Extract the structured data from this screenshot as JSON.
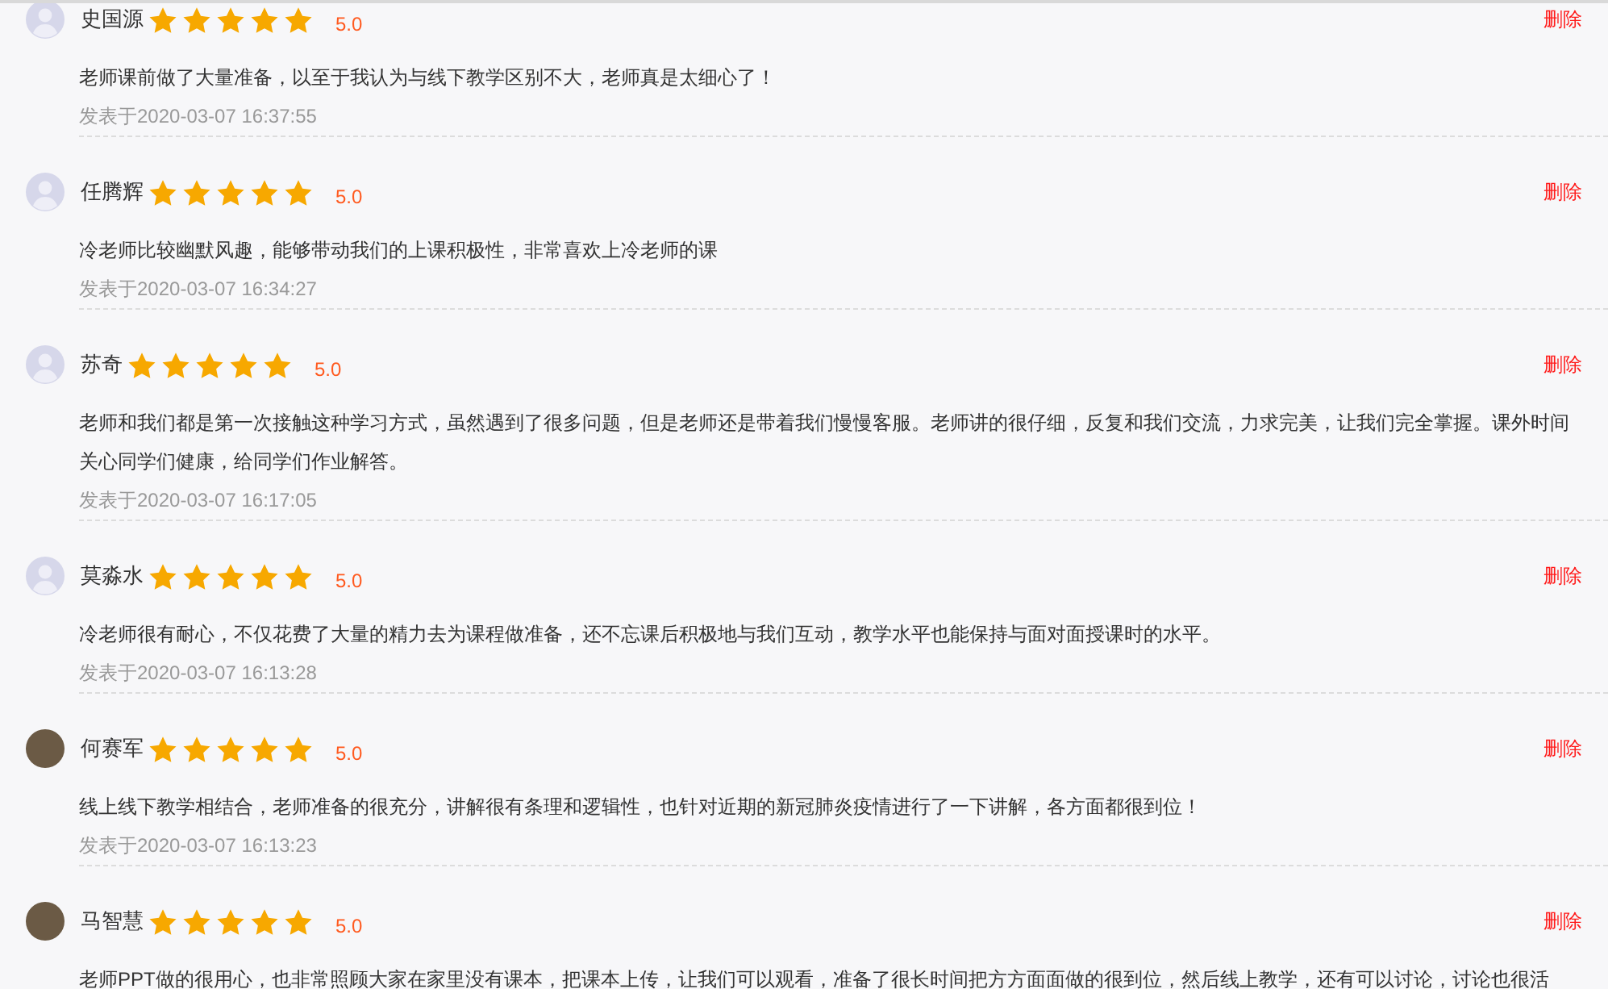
{
  "reviews": [
    {
      "name": "史国源",
      "avatar": {
        "kind": "default"
      },
      "stars": 5,
      "score": "5.0",
      "delete": "删除",
      "comment": "老师课前做了大量准备，以至于我认为与线下教学区别不大，老师真是太细心了！",
      "date": "发表于2020-03-07 16:37:55"
    },
    {
      "name": "任腾辉",
      "avatar": {
        "kind": "default"
      },
      "stars": 5,
      "score": "5.0",
      "delete": "删除",
      "comment": "冷老师比较幽默风趣，能够带动我们的上课积极性，非常喜欢上冷老师的课",
      "date": "发表于2020-03-07 16:34:27"
    },
    {
      "name": "苏奇",
      "avatar": {
        "kind": "default"
      },
      "stars": 5,
      "score": "5.0",
      "delete": "删除",
      "comment": "老师和我们都是第一次接触这种学习方式，虽然遇到了很多问题，但是老师还是带着我们慢慢客服。老师讲的很仔细，反复和我们交流，力求完美，让我们完全掌握。课外时间关心同学们健康，给同学们作业解答。",
      "date": "发表于2020-03-07 16:17:05"
    },
    {
      "name": "莫淼水",
      "avatar": {
        "kind": "default"
      },
      "stars": 5,
      "score": "5.0",
      "delete": "删除",
      "comment": "冷老师很有耐心，不仅花费了大量的精力去为课程做准备，还不忘课后积极地与我们互动，教学水平也能保持与面对面授课时的水平。",
      "date": "发表于2020-03-07 16:13:28"
    },
    {
      "name": "何赛军",
      "avatar": {
        "kind": "photo"
      },
      "stars": 5,
      "score": "5.0",
      "delete": "删除",
      "comment": "线上线下教学相结合，老师准备的很充分，讲解很有条理和逻辑性，也针对近期的新冠肺炎疫情进行了一下讲解，各方面都很到位！",
      "date": "发表于2020-03-07 16:13:23"
    },
    {
      "name": "马智慧",
      "avatar": {
        "kind": "photo"
      },
      "stars": 5,
      "score": "5.0",
      "delete": "删除",
      "comment": "老师PPT做的很用心，也非常照顾大家在家里没有课本，把课本上传，让我们可以观看，准备了很长时间把方方面面做的很到位，然后线上教学，还有可以讨论，讨论也很活"
    }
  ]
}
